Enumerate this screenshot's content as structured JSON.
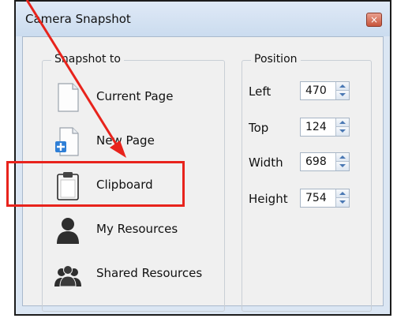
{
  "window": {
    "title": "Camera Snapshot",
    "close_label": "×"
  },
  "snapshot_group": {
    "legend": "Snapshot to",
    "items": [
      {
        "label": "Current Page"
      },
      {
        "label": "New Page"
      },
      {
        "label": "Clipboard"
      },
      {
        "label": "My Resources"
      },
      {
        "label": "Shared Resources"
      }
    ]
  },
  "position_group": {
    "legend": "Position",
    "fields": [
      {
        "label": "Left",
        "value": "470"
      },
      {
        "label": "Top",
        "value": "124"
      },
      {
        "label": "Width",
        "value": "698"
      },
      {
        "label": "Height",
        "value": "754"
      }
    ]
  },
  "annotation": {
    "highlight_color": "#e8231c",
    "target": "Clipboard"
  }
}
